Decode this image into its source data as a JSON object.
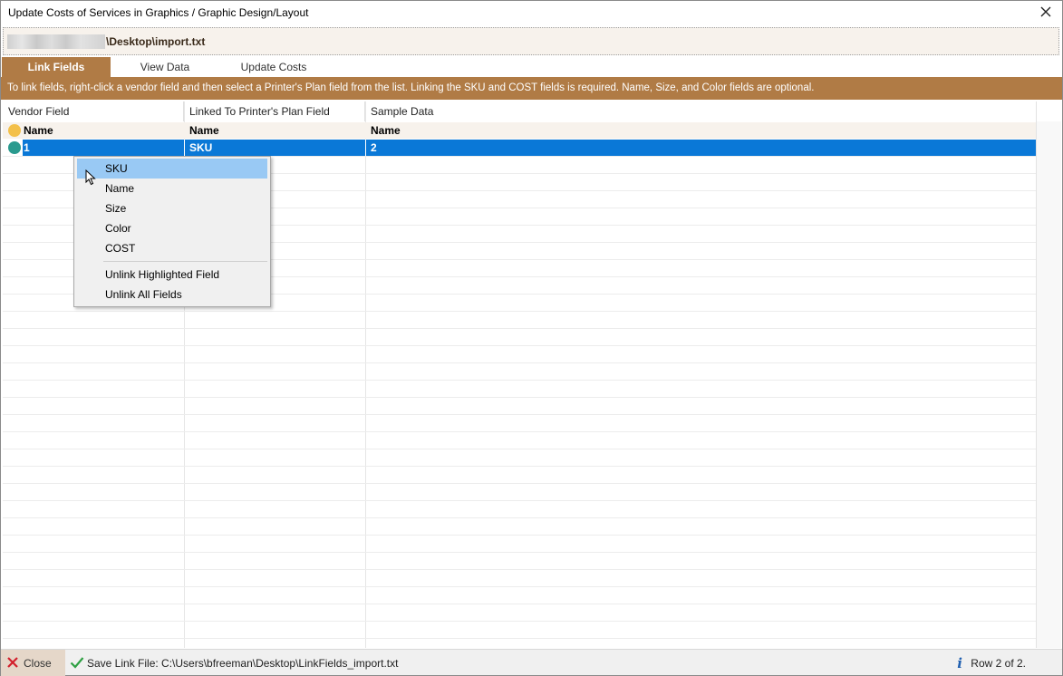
{
  "window": {
    "title": "Update Costs of Services in Graphics / Graphic Design/Layout"
  },
  "path": {
    "file_path": "\\Desktop\\import.txt"
  },
  "tabs": [
    {
      "label": "Link Fields",
      "active": true
    },
    {
      "label": "View Data",
      "active": false
    },
    {
      "label": "Update Costs",
      "active": false
    }
  ],
  "instructions": "To link fields, right-click a vendor field and then select a Printer's Plan field from the list. Linking the SKU and COST fields is required. Name, Size, and Color fields are optional.",
  "grid": {
    "columns": [
      "Vendor Field",
      "Linked To Printer's Plan Field",
      "Sample Data"
    ],
    "rows": [
      {
        "vendor": "Name",
        "linked": "Name",
        "sample": "Name",
        "dot_color": "#f3c04a",
        "selected": false
      },
      {
        "vendor": "1",
        "linked": "SKU",
        "sample": "2",
        "dot_color": "#2a9a8e",
        "selected": true
      }
    ]
  },
  "context_menu": {
    "items": [
      {
        "label": "SKU",
        "highlighted": true
      },
      {
        "label": "Name",
        "highlighted": false
      },
      {
        "label": "Size",
        "highlighted": false
      },
      {
        "label": "Color",
        "highlighted": false
      },
      {
        "label": "COST",
        "highlighted": false
      }
    ],
    "actions": [
      {
        "label": "Unlink Highlighted Field"
      },
      {
        "label": "Unlink All Fields"
      }
    ]
  },
  "statusbar": {
    "close_label": "Close",
    "save_label": "Save Link File: C:\\Users\\bfreeman\\Desktop\\LinkFields_import.txt",
    "row_status": "Row 2 of 2."
  },
  "colors": {
    "accent": "#b07b45",
    "selection": "#0a78d7",
    "menu_highlight": "#99c9f4"
  }
}
